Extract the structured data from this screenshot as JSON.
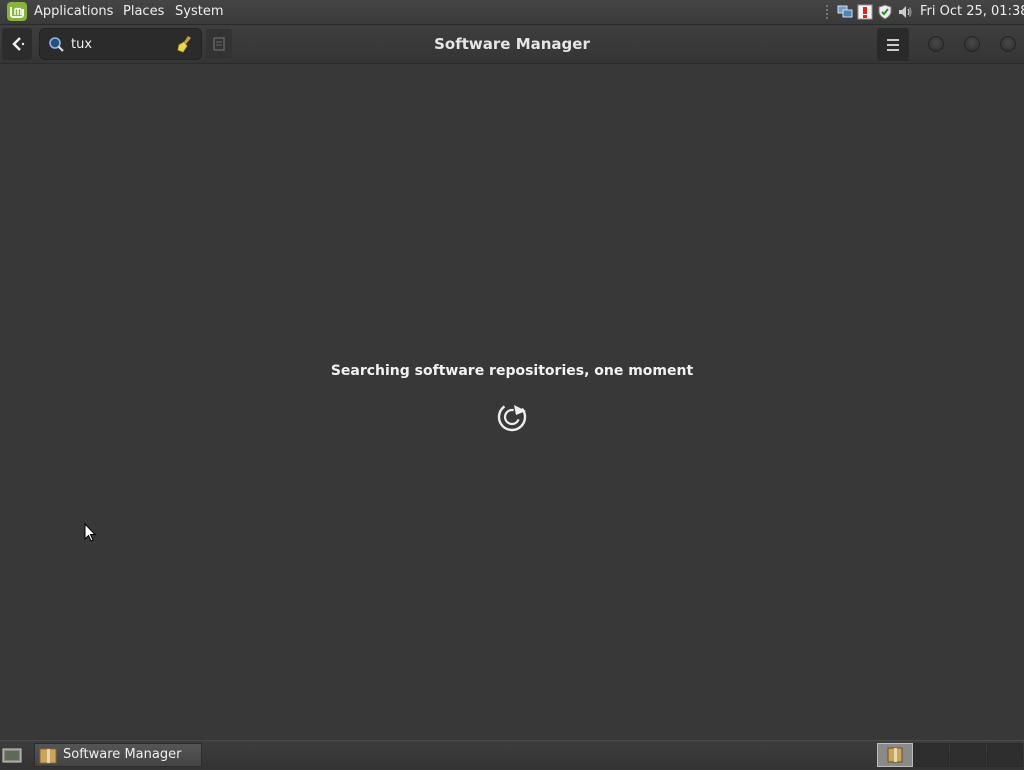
{
  "top_panel": {
    "menu": [
      "Applications",
      "Places",
      "System"
    ],
    "clock": "Fri Oct 25, 01:38",
    "tray_icons": [
      "network-icon",
      "update-alert-icon",
      "shield-icon",
      "volume-icon"
    ]
  },
  "header": {
    "title": "Software Manager",
    "search_value": "tux"
  },
  "main": {
    "status_message": "Searching software repositories, one moment"
  },
  "taskbar": {
    "window_label": "Software Manager",
    "workspaces": 4,
    "active_workspace": 1
  },
  "colors": {
    "background": "#383838",
    "mint_green": "#87b53c"
  }
}
